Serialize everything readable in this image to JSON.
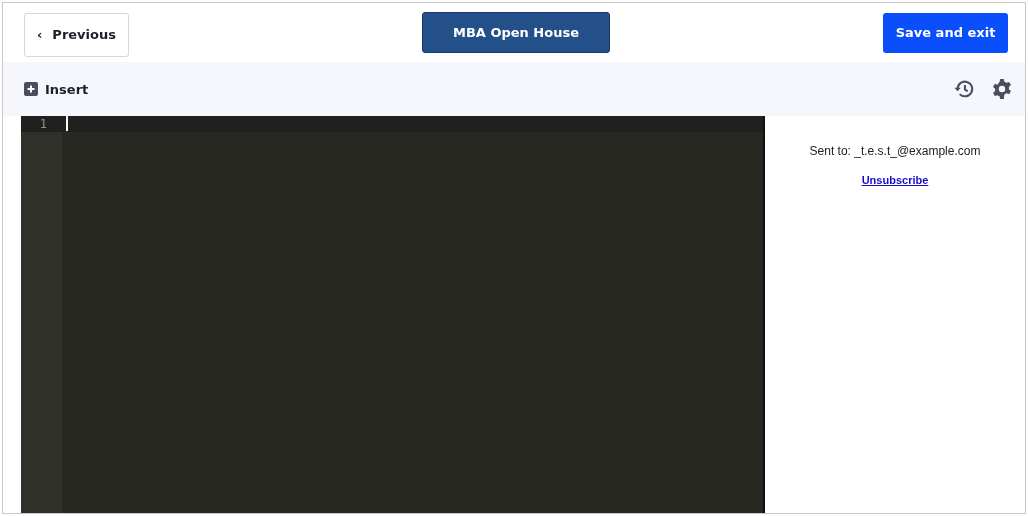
{
  "header": {
    "back_button": {
      "icon": "‹",
      "label": "Previous"
    },
    "title_button": "MBA Open House",
    "save_button": "Save and exit"
  },
  "toolbar": {
    "insert_button": "Insert"
  },
  "editor": {
    "lines": [
      {
        "number": "1",
        "active": true
      }
    ]
  },
  "preview": {
    "sent_to": "Sent to: _t.e.s.t_@example.com",
    "unsubscribe_link": "Unsubscribe"
  }
}
